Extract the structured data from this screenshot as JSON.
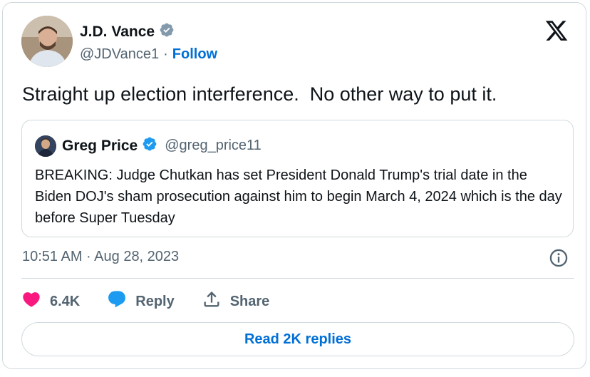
{
  "author": {
    "name": "J.D. Vance",
    "handle": "@JDVance1",
    "separator": "·",
    "follow_label": "Follow",
    "verified": "gray-verified-badge"
  },
  "tweet": {
    "text": "Straight up election interference.  No other way to put it.",
    "timestamp": "10:51 AM · Aug 28, 2023"
  },
  "quoted": {
    "name": "Greg Price",
    "handle": "@greg_price11",
    "verified": "blue-verified-badge",
    "text": "BREAKING: Judge Chutkan has set President Donald Trump's trial date in the Biden DOJ's sham prosecution against him to begin March 4, 2024 which is the day before Super Tuesday"
  },
  "actions": {
    "likes": "6.4K",
    "reply_label": "Reply",
    "share_label": "Share"
  },
  "replies_button": "Read 2K replies",
  "colors": {
    "like": "#f91880",
    "reply_icon": "#1d9bf0",
    "link": "#006fd6",
    "muted": "#536471",
    "border": "#cfd9de"
  }
}
